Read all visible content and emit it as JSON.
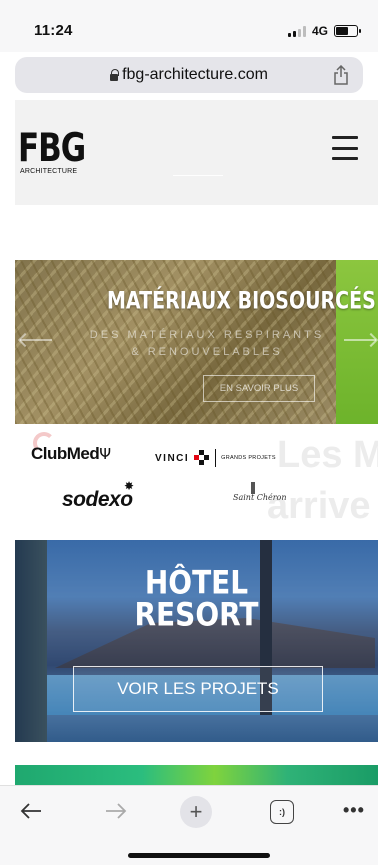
{
  "status_bar": {
    "time": "11:24",
    "network": "4G"
  },
  "browser": {
    "url": "fbg-architecture.com"
  },
  "header": {
    "logo_text": "FBG",
    "logo_subtext": "ARCHITECTURE"
  },
  "slider": {
    "title": "MATÉRIAUX BIOSOURCÉS",
    "subtitle_line1": "DES MATÉRIAUX RESPIRANTS",
    "subtitle_line2": "& RENOUVELABLES",
    "cta": "EN SAVOIR PLUS"
  },
  "clients": {
    "clubmed": "ClubMed",
    "trident_glyph": "Ψ",
    "vinci": "VINCI",
    "vinci_tag": "GRANDS PROJETS",
    "sodexo": "sodexo",
    "script_logo": "Saint Chéron",
    "background_line1": "Les M",
    "background_line2": "arrive"
  },
  "hotel": {
    "title_line1": "HÔTEL",
    "title_line2": "RESORT",
    "cta": "VOIR LES PROJETS"
  },
  "toolbar": {
    "plus": "+",
    "tabs_label": ":)",
    "more": "•••"
  },
  "colors": {
    "slider_green": "#8cc63f",
    "strip_green": "#2bbd7e",
    "url_bar": "#e5e5ea"
  }
}
